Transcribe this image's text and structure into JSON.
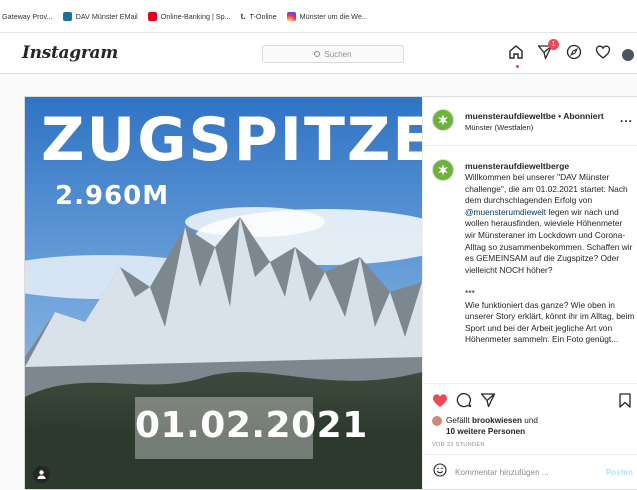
{
  "bookmarks": [
    {
      "label": "Gateway Prov...",
      "icon": "gateway-icon"
    },
    {
      "label": "DAV Münster EMail",
      "icon": "dav-icon"
    },
    {
      "label": "Online-Banking | Sp...",
      "icon": "bank-icon"
    },
    {
      "label": "T-Online",
      "icon": "t-online-icon"
    },
    {
      "label": "Münster um die We...",
      "icon": "instagram-bookmark-icon"
    }
  ],
  "header": {
    "logo": "Instagram",
    "search_placeholder": "Suchen",
    "messages_badge": "1"
  },
  "post": {
    "username": "muensteraufdieweltbe",
    "follow_separator": "•",
    "follow_label": "Abonniert",
    "location": "Münster (Westfalen)",
    "more_label": "...",
    "photo": {
      "title": "ZUGSPITZE",
      "height": "2.960M",
      "date": "01.02.2021"
    },
    "caption": {
      "username": "muensteraufdieweltberge",
      "text_part1": "Willkommen bei unserer \"DAV Münster challenge\", die am 01.02.2021 startet: Nach dem durchschlagenden Erfolg von ",
      "mention": "@muensterumdiewelt",
      "text_part2": " legen wir nach und wollen herausfinden, wieviele Höhenmeter wir Münsteraner im Lockdown und Corona-Alltag so zusammenbekommen. Schaffen wir es GEMEINSAM auf die Zugspitze? Oder vielleicht NOCH höher?\n\n***\nWie funktioniert das ganze? Wie oben in unserer Story erklärt, könnt ihr im Alltag, beim Sport und bei der Arbeit jegliche Art von Höhenmeter sammeln. Ein Foto genügt..."
    },
    "likes": {
      "prefix": "Gefällt",
      "user": "brookwiesen",
      "conjunction": "und",
      "others": "10 weitere Personen"
    },
    "time": "VOR 23 STUNDEN",
    "comment_placeholder": "Kommentar hinzufügen ...",
    "post_button": "Posten"
  },
  "colors": {
    "like_red": "#ed4956",
    "brand_green": "#6bb33a",
    "post_button": "#b2dffc"
  }
}
